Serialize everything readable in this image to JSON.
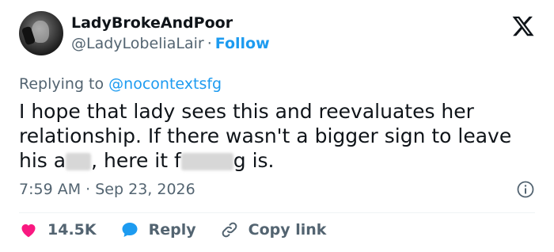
{
  "author": {
    "display_name": "LadyBrokeAndPoor",
    "handle": "@LadyLobeliaLair",
    "separator": "·",
    "follow_label": "Follow"
  },
  "reply": {
    "prefix": "Replying to",
    "mention": "@nocontextsfg"
  },
  "tweet": {
    "line1": "I hope that lady sees this and reevaluates her",
    "line2": "relationship. If there wasn't a bigger sign to leave",
    "line3_a": "his a",
    "line3_b": ", here it f",
    "line3_c": "g is."
  },
  "meta": {
    "time": "7:59 AM",
    "separator": "·",
    "date": "Sep 23, 2026"
  },
  "actions": {
    "likes": "14.5K",
    "reply_label": "Reply",
    "copy_label": "Copy link"
  },
  "icons": {
    "x_logo": "x-logo-icon",
    "info": "info-icon",
    "heart": "heart-icon",
    "reply": "reply-bubble-icon",
    "link": "link-icon"
  },
  "colors": {
    "accent": "#1d9bf0",
    "heart": "#f91880",
    "muted": "#536471",
    "text": "#0f1419"
  }
}
